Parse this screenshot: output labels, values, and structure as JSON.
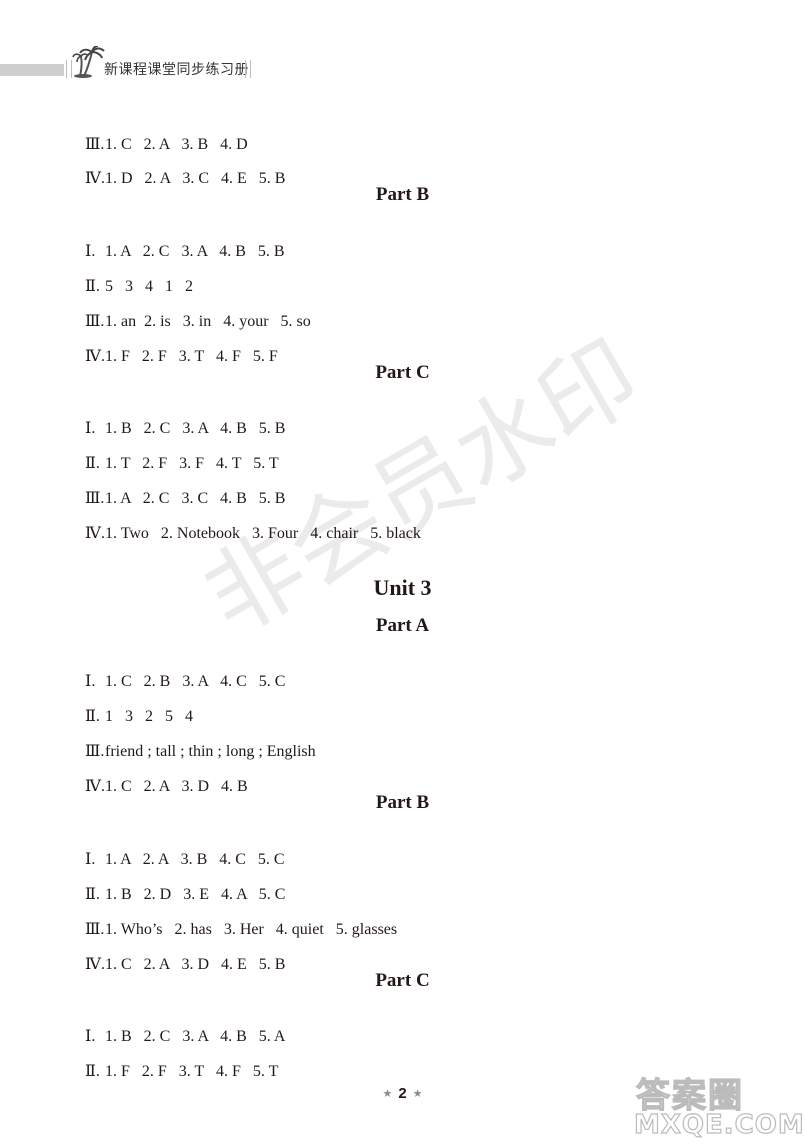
{
  "header": {
    "title": "新课程课堂同步练习册",
    "logo_icon": "palm-tree-icon"
  },
  "unit2_continued": {
    "part_a_tail": [
      {
        "roman": "Ⅲ.",
        "answers": "1. C   2. A   3. B   4. D"
      },
      {
        "roman": "Ⅳ.",
        "answers": "1. D   2. A   3. C   4. E   5. B"
      }
    ],
    "part_b": {
      "heading": "Part  B",
      "lines": [
        {
          "roman": "Ⅰ.",
          "answers": "1. A   2. C   3. A   4. B   5. B"
        },
        {
          "roman": "Ⅱ.",
          "answers": "5   3   4   1   2"
        },
        {
          "roman": "Ⅲ.",
          "answers": "1. an  2. is   3. in   4. your   5. so"
        },
        {
          "roman": "Ⅳ.",
          "answers": "1. F   2. F   3. T   4. F   5. F"
        }
      ]
    },
    "part_c": {
      "heading": "Part  C",
      "lines": [
        {
          "roman": "Ⅰ.",
          "answers": "1. B   2. C   3. A   4. B   5. B"
        },
        {
          "roman": "Ⅱ.",
          "answers": "1. T   2. F   3. F   4. T   5. T"
        },
        {
          "roman": "Ⅲ.",
          "answers": "1. A   2. C   3. C   4. B   5. B"
        },
        {
          "roman": "Ⅳ.",
          "answers": "1. Two   2. Notebook   3. Four   4. chair   5. black"
        }
      ]
    }
  },
  "unit3": {
    "heading": "Unit  3",
    "part_a": {
      "heading": "Part  A",
      "lines": [
        {
          "roman": "Ⅰ.",
          "answers": "1. C   2. B   3. A   4. C   5. C"
        },
        {
          "roman": "Ⅱ.",
          "answers": "1   3   2   5   4"
        },
        {
          "roman": "Ⅲ.",
          "answers": "friend ; tall ; thin ; long ; English"
        },
        {
          "roman": "Ⅳ.",
          "answers": "1. C   2. A   3. D   4. B"
        }
      ]
    },
    "part_b": {
      "heading": "Part  B",
      "lines": [
        {
          "roman": "Ⅰ.",
          "answers": "1. A   2. A   3. B   4. C   5. C"
        },
        {
          "roman": "Ⅱ.",
          "answers": "1. B   2. D   3. E   4. A   5. C"
        },
        {
          "roman": "Ⅲ.",
          "answers": "1. Who’s   2. has   3. Her   4. quiet   5. glasses"
        },
        {
          "roman": "Ⅳ.",
          "answers": "1. C   2. A   3. D   4. E   5. B"
        }
      ]
    },
    "part_c": {
      "heading": "Part  C",
      "lines": [
        {
          "roman": "Ⅰ.",
          "answers": "1. B   2. C   3. A   4. B   5. A"
        },
        {
          "roman": "Ⅱ.",
          "answers": "1. F   2. F   3. T   4. F   5. T"
        }
      ]
    }
  },
  "watermark": {
    "text": "非会员水印"
  },
  "footer": {
    "page_number": "2",
    "star": "★"
  },
  "site_stamp": {
    "line1": "答案圈",
    "line2": "MXQE.COM"
  }
}
